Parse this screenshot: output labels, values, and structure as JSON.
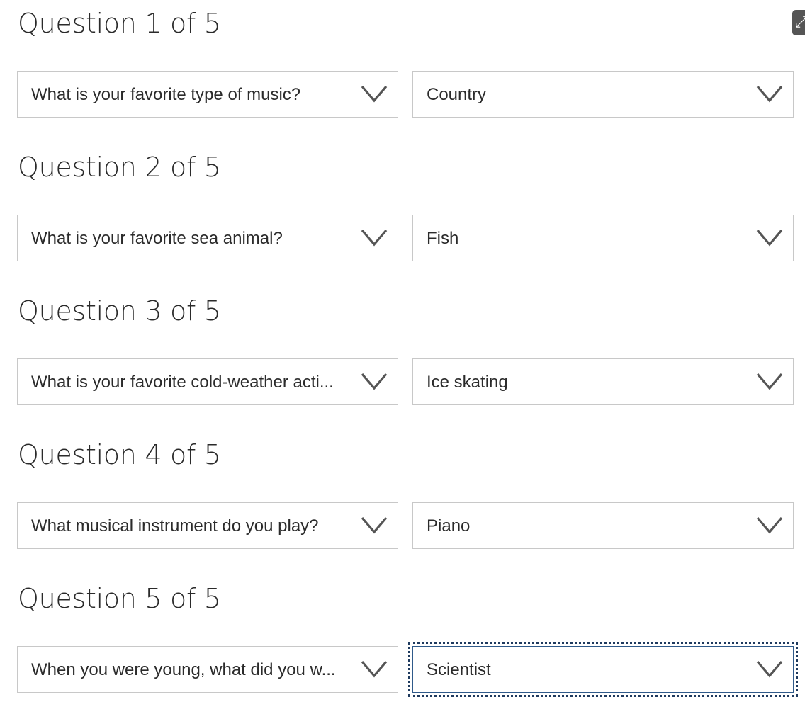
{
  "questions": [
    {
      "title": "Question 1 of 5",
      "question_value": "What is your favorite type of music?",
      "answer_value": "Country"
    },
    {
      "title": "Question 2 of 5",
      "question_value": "What is your favorite sea animal?",
      "answer_value": "Fish"
    },
    {
      "title": "Question 3 of 5",
      "question_value": "What is your favorite cold-weather acti...",
      "answer_value": "Ice skating"
    },
    {
      "title": "Question 4 of 5",
      "question_value": "What musical instrument do you play?",
      "answer_value": "Piano"
    },
    {
      "title": "Question 5 of 5",
      "question_value": "When you were young, what did you w...",
      "answer_value": "Scientist"
    }
  ],
  "icons": {
    "dropdown": "chevron-down-icon",
    "corner": "expand-icon"
  },
  "colors": {
    "border": "#c8c8c8",
    "focus_outline": "#1e3a5f",
    "chevron": "#555555"
  }
}
